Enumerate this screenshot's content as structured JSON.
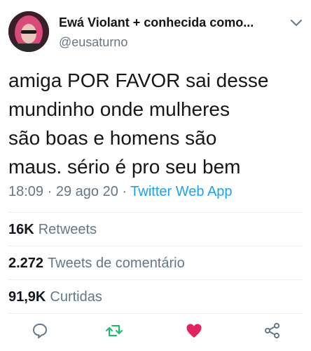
{
  "author": {
    "display_name": "Ewá Violant + conhecida como...",
    "handle": "@eusaturno"
  },
  "tweet": {
    "text": "amiga POR FAVOR sai desse\nmundinho onde mulheres\nsão boas e homens são\nmaus. sério é pro seu bem",
    "time": "18:09",
    "date": "29 ago 20",
    "separator": "·",
    "app": "Twitter Web App"
  },
  "stats": {
    "retweets": {
      "value": "16K",
      "label": "Retweets"
    },
    "comment_tweets": {
      "value": "2.272",
      "label": "Tweets de comentário"
    },
    "likes": {
      "value": "91,9K",
      "label": "Curtidas"
    }
  },
  "colors": {
    "accent": "#1da1f2",
    "like": "#e0245e",
    "retweet": "#17bf63",
    "muted": "#657786"
  },
  "icons": [
    "chevron-down-icon",
    "reply-icon",
    "retweet-icon",
    "like-icon",
    "share-icon"
  ]
}
